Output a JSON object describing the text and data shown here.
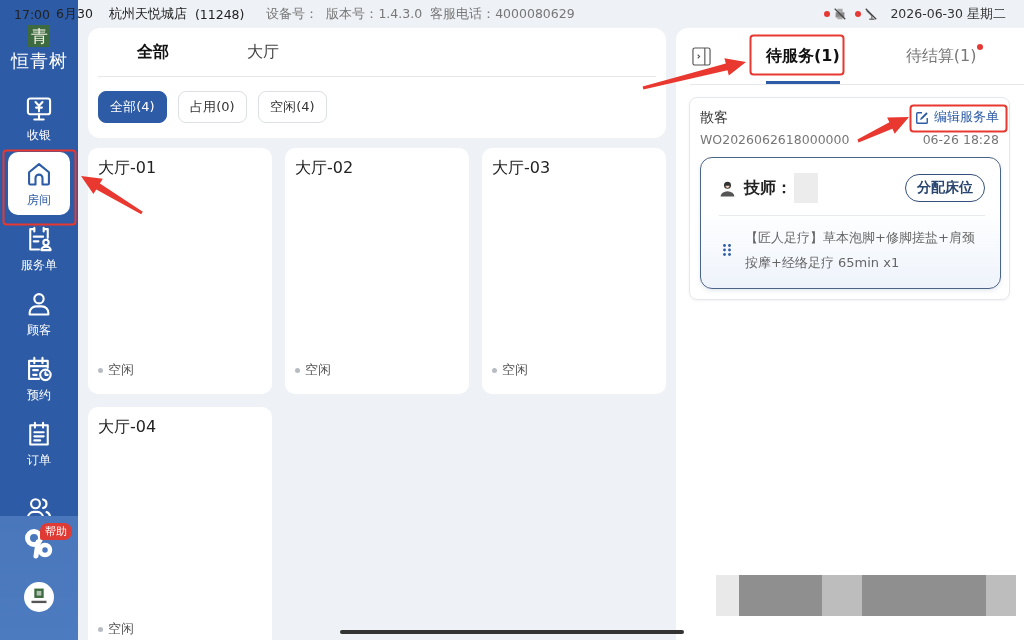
{
  "status_bar": {
    "time": "17:00",
    "date": "6月30",
    "store": "杭州天悦城店",
    "store_code": "(11248)",
    "device_label": "设备号：",
    "version": "版本号：1.4.3.0",
    "hotline": "客服电话：4000080629",
    "indicators": [
      {
        "kind": "printer",
        "alert": true
      },
      {
        "kind": "signal",
        "alert": true
      }
    ],
    "datetime": "2026-06-30 星期二"
  },
  "sidebar": {
    "brand_mark": "青",
    "brand": "恒青树",
    "items": [
      {
        "kind": "cashier",
        "label": "收银",
        "selected": false
      },
      {
        "kind": "room",
        "label": "房间",
        "selected": true
      },
      {
        "kind": "service",
        "label": "服务单",
        "selected": false
      },
      {
        "kind": "customer",
        "label": "顾客",
        "selected": false
      },
      {
        "kind": "booking",
        "label": "预约",
        "selected": false
      },
      {
        "kind": "order",
        "label": "订单",
        "selected": false
      },
      {
        "kind": "staff",
        "selected": false
      }
    ],
    "help_badge": "帮助"
  },
  "rooms_view": {
    "area_tabs": [
      {
        "label": "全部",
        "selected": true
      },
      {
        "label": "大厅",
        "selected": false
      }
    ],
    "filters": [
      {
        "label": "全部(4)",
        "selected": true
      },
      {
        "label": "占用(0)",
        "selected": false
      },
      {
        "label": "空闲(4)",
        "selected": false
      }
    ],
    "rooms": [
      {
        "name": "大厅-01",
        "status": "空闲"
      },
      {
        "name": "大厅-02",
        "status": "空闲"
      },
      {
        "name": "大厅-03",
        "status": "空闲"
      },
      {
        "name": "大厅-04",
        "status": "空闲"
      }
    ]
  },
  "order_panel": {
    "tabs": [
      {
        "label": "待服务(1)",
        "selected": true,
        "unread": false
      },
      {
        "label": "待结算(1)",
        "selected": false,
        "unread": true
      }
    ],
    "orders": [
      {
        "customer": "散客",
        "edit_label": "编辑服务单",
        "number": "WO2026062618000000",
        "time": "06-26 18:28",
        "technician_label": "技师：",
        "assign_label": "分配床位",
        "service": "【匠人足疗】草本泡脚+修脚搓盐+肩颈按摩+经络足疗 65min x1"
      }
    ]
  }
}
